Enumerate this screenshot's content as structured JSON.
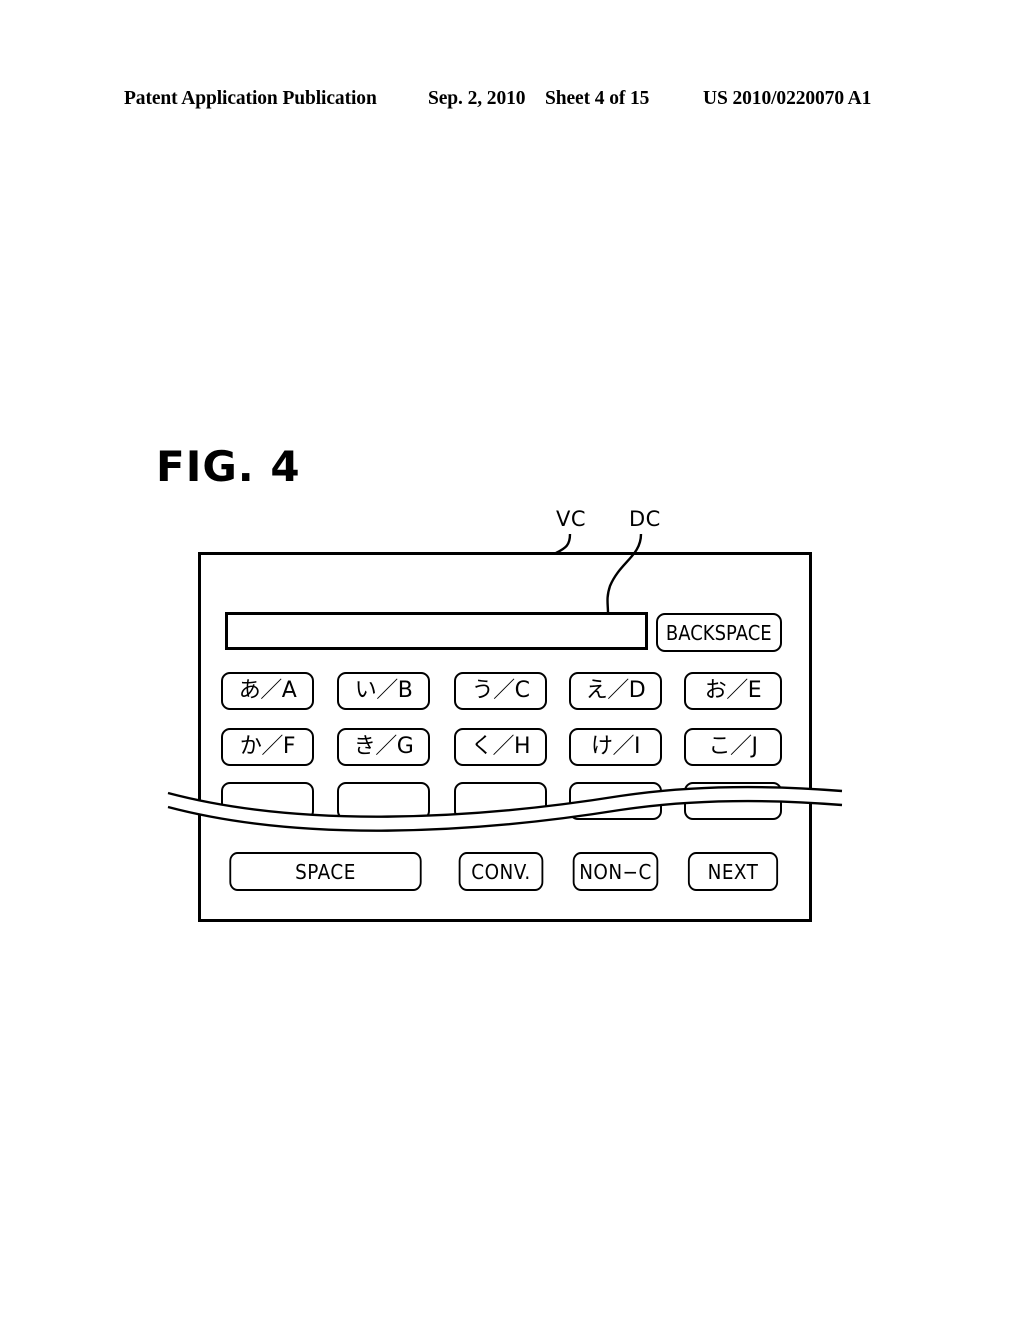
{
  "header": {
    "publication": "Patent Application Publication",
    "date": "Sep. 2, 2010",
    "sheet": "Sheet 4 of 15",
    "number": "US 2010/0220070 A1"
  },
  "figure": {
    "label": "FIG. 4",
    "callouts": [
      {
        "id": "VC",
        "text": "VC",
        "points_to": "device-outer-frame"
      },
      {
        "id": "DC",
        "text": "DC",
        "points_to": "display-field"
      }
    ]
  },
  "device": {
    "display": {
      "name": "display-field",
      "value": "",
      "placeholder": ""
    },
    "backspace": {
      "label": "BACKSPACE"
    },
    "key_rows": [
      {
        "row": 1,
        "keys": [
          {
            "label": "あ／A",
            "kana": "あ",
            "latin": "A"
          },
          {
            "label": "い／B",
            "kana": "い",
            "latin": "B"
          },
          {
            "label": "う／C",
            "kana": "う",
            "latin": "C"
          },
          {
            "label": "え／D",
            "kana": "え",
            "latin": "D"
          },
          {
            "label": "お／E",
            "kana": "お",
            "latin": "E"
          }
        ]
      },
      {
        "row": 2,
        "keys": [
          {
            "label": "か／F",
            "kana": "か",
            "latin": "F"
          },
          {
            "label": "き／G",
            "kana": "き",
            "latin": "G"
          },
          {
            "label": "く／H",
            "kana": "く",
            "latin": "H"
          },
          {
            "label": "け／I",
            "kana": "け",
            "latin": "I"
          },
          {
            "label": "こ／J",
            "kana": "こ",
            "latin": "J"
          }
        ]
      },
      {
        "row": 3,
        "truncated_by_break_line": true,
        "keys": [
          {
            "label": ""
          },
          {
            "label": ""
          },
          {
            "label": ""
          },
          {
            "label": ""
          },
          {
            "label": ""
          }
        ]
      }
    ],
    "function_row": [
      {
        "label": "SPACE",
        "width": "double"
      },
      {
        "label": "CONV.",
        "width": "single"
      },
      {
        "label": "NON−C",
        "width": "single"
      },
      {
        "label": "NEXT",
        "width": "single"
      }
    ]
  },
  "colors": {
    "line": "#000000",
    "background": "#ffffff"
  }
}
